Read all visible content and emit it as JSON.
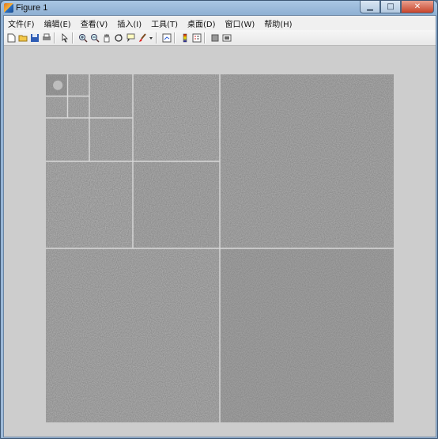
{
  "window": {
    "title": "Figure 1"
  },
  "menu": [
    "文件(F)",
    "编辑(E)",
    "查看(V)",
    "插入(I)",
    "工具(T)",
    "桌面(D)",
    "窗口(W)",
    "帮助(H)"
  ],
  "toolbar_icons": [
    "new-figure-icon",
    "open-file-icon",
    "save-icon",
    "print-icon",
    "edit-plot-arrow-icon",
    "zoom-in-icon",
    "zoom-out-icon",
    "pan-hand-icon",
    "rotate-3d-icon",
    "data-cursor-icon",
    "brush-icon",
    "brush-dropdown-icon",
    "link-plot-icon",
    "insert-colorbar-icon",
    "insert-legend-icon",
    "hide-plot-tools-icon",
    "show-plot-tools-icon"
  ],
  "figure": {
    "content": "wavelet decomposition image (grayscale detail subbands)",
    "colors": {
      "background": "#cdcdcd",
      "image_mid_gray": "#7f7f7f",
      "grid_lines": "#d8d8d8"
    }
  }
}
